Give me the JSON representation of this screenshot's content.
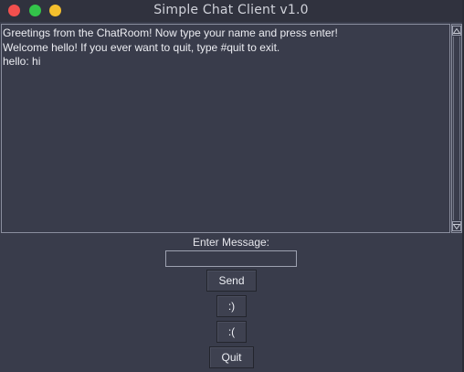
{
  "window": {
    "title": "Simple Chat Client v1.0",
    "controls": [
      "close",
      "minimize",
      "maximize"
    ]
  },
  "chat": {
    "lines": [
      "Greetings from the ChatRoom! Now type your name and press enter!",
      "Welcome hello! If you ever want to quit, type #quit to exit.",
      "hello: hi"
    ]
  },
  "composer": {
    "label": "Enter Message:",
    "input_value": "",
    "send_label": "Send",
    "smile_label": ":)",
    "frown_label": ":(",
    "quit_label": "Quit"
  },
  "colors": {
    "background": "#393c4b",
    "titlebar": "#30323e",
    "close": "#f2504e",
    "minimize": "#33c44a",
    "maximize": "#f4bf2d",
    "text": "#ecedf2"
  },
  "icons": {
    "scroll_up": "triangle-up-icon",
    "scroll_down": "triangle-down-icon"
  }
}
